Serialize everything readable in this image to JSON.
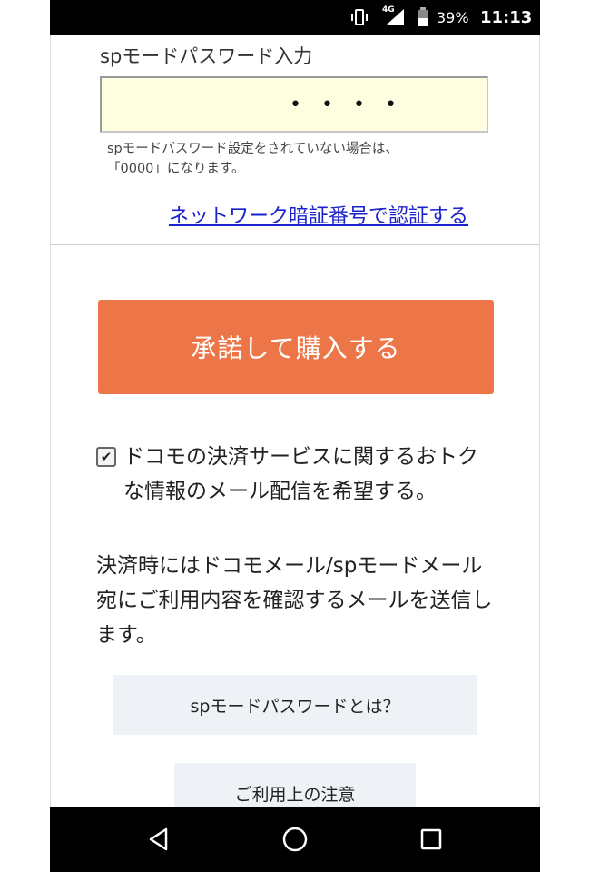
{
  "status_bar": {
    "network": "4G",
    "battery": "39%",
    "time": "11:13",
    "icons": [
      "vibrate-icon",
      "signal-icon",
      "battery-icon"
    ]
  },
  "password": {
    "label": "spモードパスワード入力",
    "value_masked": "••••",
    "note_line1": "spモードパスワード設定をされていない場合は、",
    "note_line2": "「0000」になります。"
  },
  "auth_link": "ネットワーク暗証番号で認証する",
  "purchase_button": "承諾して購入する",
  "optin": {
    "checked": true,
    "text": "ドコモの決済サービスに関するおトクな情報のメール配信を希望する。"
  },
  "notice": "決済時にはドコモメール/spモードメール宛にご利用内容を確認するメールを送信します。",
  "help_button": "spモードパスワードとは？",
  "caution_button": "ご利用上の注意",
  "nav": {
    "back": "back-icon",
    "home": "home-icon",
    "recents": "recents-icon"
  },
  "colors": {
    "primary_button": "#ec7648",
    "link": "#1a22cc",
    "input_bg": "#fffee0",
    "secondary_button": "#eef2f6"
  }
}
